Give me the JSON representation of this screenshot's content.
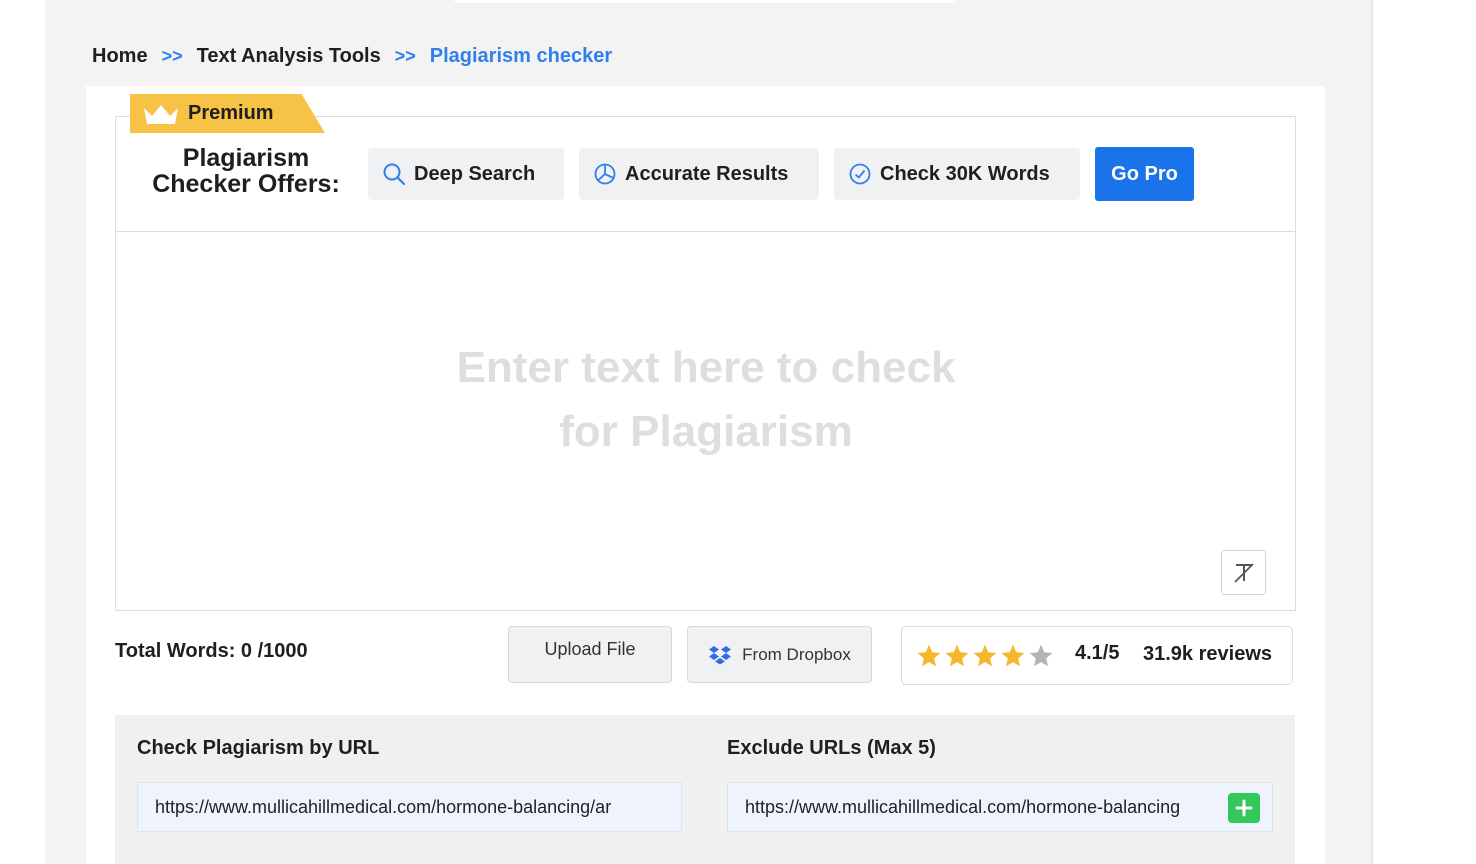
{
  "breadcrumb": {
    "items": [
      "Home",
      "Text Analysis Tools",
      "Plagiarism checker"
    ],
    "separator": ">>"
  },
  "premium_badge": {
    "label": "Premium",
    "icon": "crown-icon",
    "color": "#f7c347"
  },
  "offers": {
    "title_line1": "Plagiarism",
    "title_line2": "Checker Offers:",
    "chips": [
      {
        "label": "Deep Search",
        "icon": "search-icon"
      },
      {
        "label": "Accurate Results",
        "icon": "pie-chart-icon"
      },
      {
        "label": "Check 30K Words",
        "icon": "check-circle-icon"
      }
    ],
    "go_pro_label": "Go Pro"
  },
  "editor": {
    "placeholder_line1": "Enter text here to check",
    "placeholder_line2": "for Plagiarism",
    "clear_icon": "clear-format-icon"
  },
  "footer": {
    "total_words_label": "Total Words: 0 /1000",
    "upload_label": "Upload File",
    "dropbox_label": "From Dropbox"
  },
  "rating": {
    "stars": 4.1,
    "max": 5,
    "value_label": "4.1/5",
    "reviews_label": "31.9k reviews"
  },
  "url_section": {
    "check_label": "Check Plagiarism by URL",
    "check_value": "https://www.mullicahillmedical.com/hormone-balancing/ar",
    "exclude_label": "Exclude URLs (Max 5)",
    "exclude_value": "https://www.mullicahillmedical.com/hormone-balancing"
  },
  "colors": {
    "accent": "#2f80ed",
    "button_primary": "#1a73e8",
    "star": "#f5b72c",
    "add_button": "#34c759"
  }
}
